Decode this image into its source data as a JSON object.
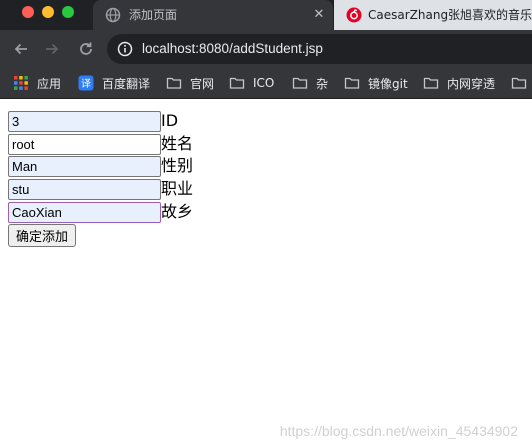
{
  "browser": {
    "tabs": [
      {
        "title": "添加页面",
        "active": true,
        "close": "✕"
      },
      {
        "title": "CaesarZhang张旭喜欢的音乐",
        "active": false
      }
    ],
    "address_bar": {
      "url": "localhost:8080/addStudent.jsp"
    },
    "bookmarks": [
      {
        "label": "应用",
        "icon": "apps-grid-icon"
      },
      {
        "label": "百度翻译",
        "icon": "translate-icon"
      },
      {
        "label": "官网",
        "icon": "folder-icon"
      },
      {
        "label": "ICO",
        "icon": "folder-icon"
      },
      {
        "label": "杂",
        "icon": "folder-icon"
      },
      {
        "label": "镜像git",
        "icon": "folder-icon"
      },
      {
        "label": "内网穿透",
        "icon": "folder-icon"
      }
    ]
  },
  "form": {
    "fields": [
      {
        "value": "3",
        "label": "ID"
      },
      {
        "value": "root",
        "label": "姓名"
      },
      {
        "value": "Man",
        "label": "性别"
      },
      {
        "value": "stu",
        "label": "职业"
      },
      {
        "value": "CaoXian",
        "label": "故乡"
      }
    ],
    "submit_label": "确定添加"
  },
  "watermark": "https://blog.csdn.net/weixin_45434902",
  "colors": {
    "tabstrip_bg": "#202124",
    "toolbar_bg": "#35363a",
    "autofill_bg": "#e8f0fe",
    "focus_border": "#9c5fb0"
  }
}
